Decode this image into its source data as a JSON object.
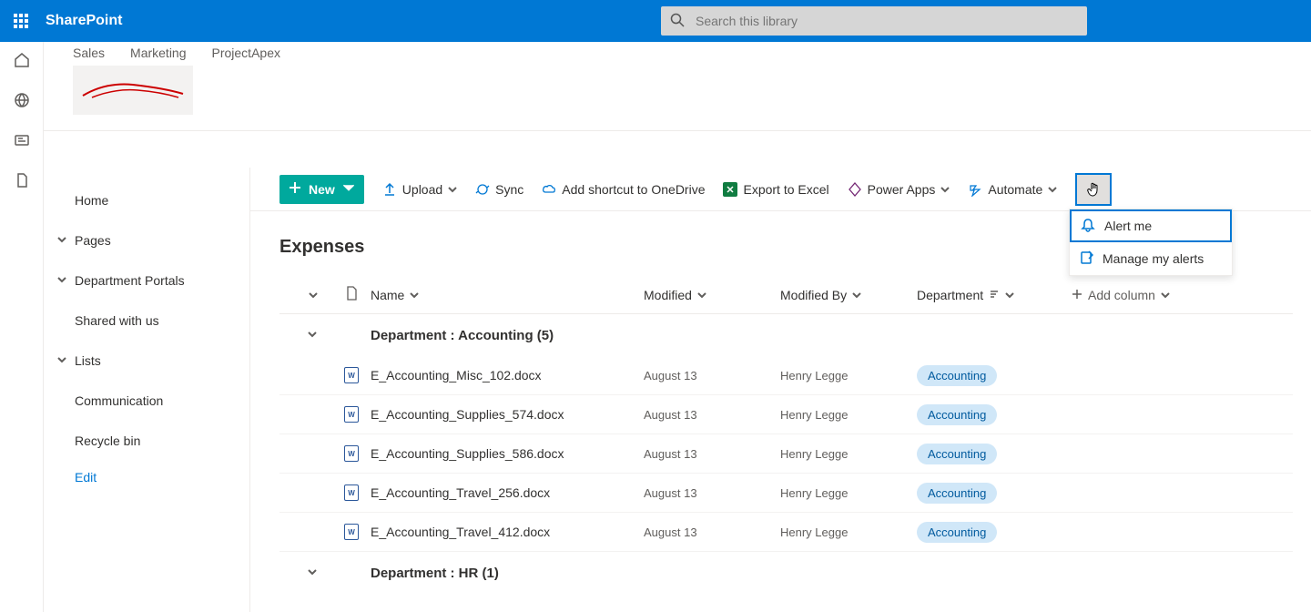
{
  "suite": {
    "brand": "SharePoint",
    "search_placeholder": "Search this library"
  },
  "hub_links": [
    "Sales",
    "Marketing",
    "ProjectApex"
  ],
  "left_nav": {
    "items": [
      {
        "label": "Home",
        "expandable": false
      },
      {
        "label": "Pages",
        "expandable": true
      },
      {
        "label": "Department Portals",
        "expandable": true
      },
      {
        "label": "Shared with us",
        "expandable": false
      },
      {
        "label": "Lists",
        "expandable": true
      },
      {
        "label": "Communication",
        "expandable": false
      },
      {
        "label": "Recycle bin",
        "expandable": false
      }
    ],
    "edit": "Edit"
  },
  "cmd": {
    "new": "New",
    "upload": "Upload",
    "sync": "Sync",
    "shortcut": "Add shortcut to OneDrive",
    "export": "Export to Excel",
    "powerapps": "Power Apps",
    "automate": "Automate"
  },
  "dropdown": {
    "alert": "Alert me",
    "manage": "Manage my alerts"
  },
  "library": {
    "title": "Expenses",
    "columns": {
      "name": "Name",
      "modified": "Modified",
      "modified_by": "Modified By",
      "department": "Department",
      "add": "Add column"
    },
    "groups": [
      {
        "label": "Department : Accounting (5)",
        "rows": [
          {
            "name": "E_Accounting_Misc_102.docx",
            "modified": "August 13",
            "by": "Henry Legge",
            "dept": "Accounting"
          },
          {
            "name": "E_Accounting_Supplies_574.docx",
            "modified": "August 13",
            "by": "Henry Legge",
            "dept": "Accounting"
          },
          {
            "name": "E_Accounting_Supplies_586.docx",
            "modified": "August 13",
            "by": "Henry Legge",
            "dept": "Accounting"
          },
          {
            "name": "E_Accounting_Travel_256.docx",
            "modified": "August 13",
            "by": "Henry Legge",
            "dept": "Accounting"
          },
          {
            "name": "E_Accounting_Travel_412.docx",
            "modified": "August 13",
            "by": "Henry Legge",
            "dept": "Accounting"
          }
        ]
      },
      {
        "label": "Department : HR (1)",
        "rows": []
      }
    ]
  }
}
